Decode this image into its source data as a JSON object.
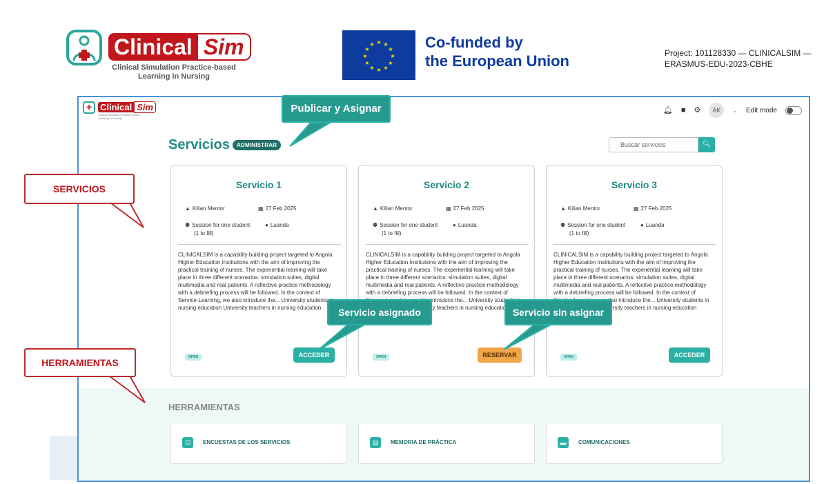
{
  "header": {
    "logo_word1": "Clinical",
    "logo_word2": "Sim",
    "logo_subtitle": "Clinical Simulation Practice-based Learning in Nursing",
    "eu_line1": "Co-funded by",
    "eu_line2": "the European Union",
    "project": "Project: 101128330 — CLINICALSIM — ERASMUS-EDU-2023-CBHE"
  },
  "topbar": {
    "avatar": "AK",
    "edit_mode": "Edit mode",
    "icons": [
      "bell-icon",
      "chat-icon",
      "gear-icon",
      "chevron-down-icon"
    ]
  },
  "services": {
    "title": "Servicios",
    "admin_label": "ADMINISTRAR",
    "search_placeholder": "Buscar servicios",
    "cards": [
      {
        "title": "Servicio 1",
        "mentor": "Kilian Mentor",
        "date": "27 Feb 2025",
        "session": "Session for one student",
        "fill": "(1 to fill)",
        "location": "Luanda",
        "description": "CLINICALSIM is a capability building project targeted to Angola Higher Education Institutions with the aim of improving the practical training of nurses. The experiential learning will take place in three different scenarios: simulation suites, digital multimedia and real patients. A reflective practice methodology with a debriefing process will be followed. In the context of Service-Learning, we also introduce the...   University students in nursing education   University teachers in nursing education",
        "status": "OPEN",
        "action": "ACCEDER",
        "action_color": "#2ab0a4"
      },
      {
        "title": "Servicio 2",
        "mentor": "Kilian Mentor",
        "date": "27 Feb 2025",
        "session": "Session for one student",
        "fill": "(1 to fill)",
        "location": "Luanda",
        "description": "CLINICALSIM is a capability building project targeted to Angola Higher Education Institutions with the aim of improving the practical training of nurses. The experiential learning will take place in three different scenarios: simulation suites, digital multimedia and real patients. A reflective practice methodology with a debriefing process will be followed. In the context of Service-Learning, we also introduce the...   University students in nursing education   University teachers in nursing education",
        "status": "OPEN",
        "action": "RESERVAR",
        "action_color": "#f0a54a"
      },
      {
        "title": "Servicio 3",
        "mentor": "Kilian Mentor",
        "date": "27 Feb 2025",
        "session": "Session for one student",
        "fill": "(1 to fill)",
        "location": "Luanda",
        "description": "CLINICALSIM is a capability building project targeted to Angola Higher Education Institutions with the aim of improving the practical training of nurses. The experiential learning will take place in three different scenarios: simulation suites, digital multimedia and real patients. A reflective practice methodology with a debriefing process will be followed. In the context of Service-Learning, we also introduce the...   University students in nursing education   University teachers in nursing education",
        "status": "OPEN",
        "action": "ACCEDER",
        "action_color": "#2ab0a4"
      }
    ]
  },
  "tools": {
    "title": "HERRAMIENTAS",
    "items": [
      {
        "label": "ENCUESTAS DE LOS SERVICIOS",
        "icon": "survey-icon"
      },
      {
        "label": "MEMORIA DE PRÁCTICA",
        "icon": "document-icon"
      },
      {
        "label": "COMUNICACIONES",
        "icon": "chat-icon"
      }
    ]
  },
  "callouts": {
    "publish": "Publicar y Asignar",
    "assigned": "Servicio asignado",
    "unassigned": "Servicio sin asignar",
    "services": "SERVICIOS",
    "tools": "HERRAMIENTAS"
  },
  "colors": {
    "teal": "#2ab0a4",
    "dark_teal": "#1f8c85",
    "orange": "#f0a54a",
    "brand_red": "#c0161c",
    "eu_blue": "#0e3b9e"
  }
}
